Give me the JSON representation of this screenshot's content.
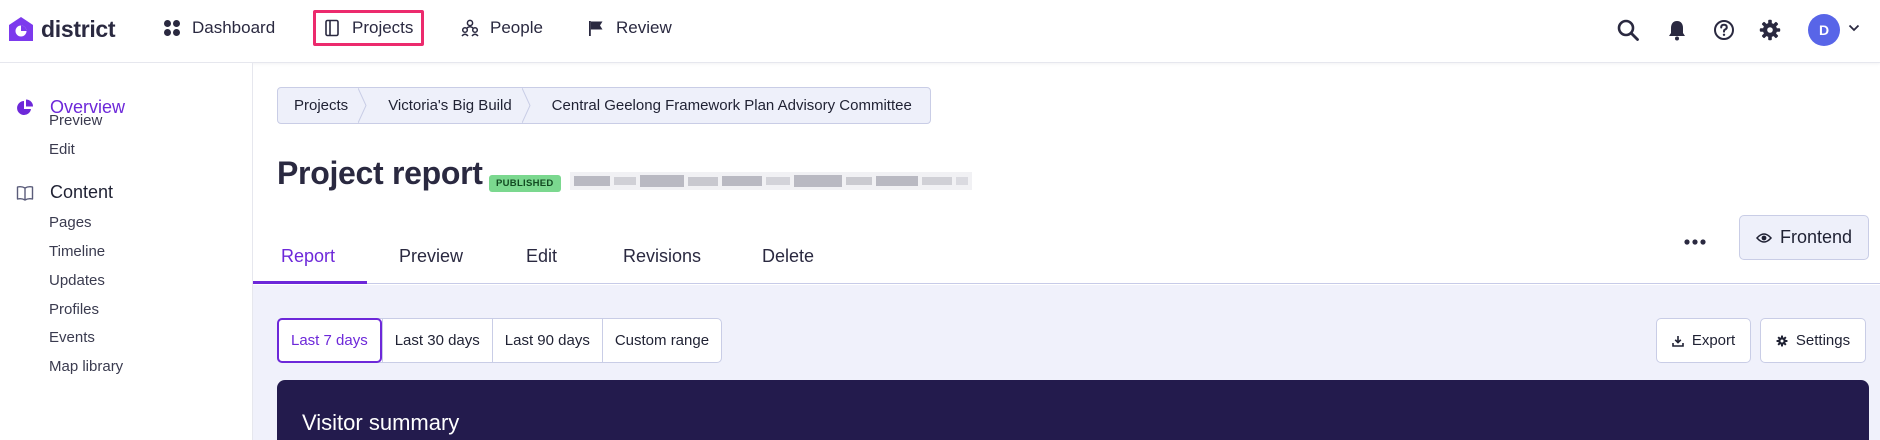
{
  "app": {
    "name": "district"
  },
  "topnav": {
    "items": [
      {
        "label": "Dashboard",
        "icon": "dashboard-icon"
      },
      {
        "label": "Projects",
        "icon": "project-book-icon",
        "highlighted": true
      },
      {
        "label": "People",
        "icon": "people-icon"
      },
      {
        "label": "Review",
        "icon": "flag-icon"
      }
    ],
    "right_icons": [
      "search-icon",
      "bell-icon",
      "help-icon",
      "gear-icon"
    ],
    "avatar_initial": "D"
  },
  "sidebar": {
    "overview": {
      "label": "Overview",
      "icon": "pie-chart-icon",
      "items": [
        "Preview",
        "Edit"
      ]
    },
    "content": {
      "label": "Content",
      "icon": "open-book-icon",
      "items": [
        "Pages",
        "Timeline",
        "Updates",
        "Profiles",
        "Events",
        "Map library"
      ]
    }
  },
  "breadcrumb": [
    "Projects",
    "Victoria's Big Build",
    "Central Geelong Framework Plan Advisory Committee"
  ],
  "page": {
    "title": "Project report",
    "status_badge": "PUBLISHED"
  },
  "tabs": [
    {
      "label": "Report",
      "active": true
    },
    {
      "label": "Preview"
    },
    {
      "label": "Edit"
    },
    {
      "label": "Revisions"
    },
    {
      "label": "Delete"
    }
  ],
  "frontend_button": "Frontend",
  "date_ranges": [
    {
      "label": "Last 7 days",
      "active": true
    },
    {
      "label": "Last 30 days"
    },
    {
      "label": "Last 90 days"
    },
    {
      "label": "Custom range"
    }
  ],
  "actions": {
    "export": "Export",
    "settings": "Settings"
  },
  "visitor_summary": {
    "title": "Visitor summary"
  },
  "colors": {
    "accent": "#6d28d9",
    "highlight_border": "#ec2a6d",
    "badge": "#7bd88f",
    "avatar": "#5865e8",
    "card": "#231b4d",
    "content_bg": "#f0f1fb"
  }
}
